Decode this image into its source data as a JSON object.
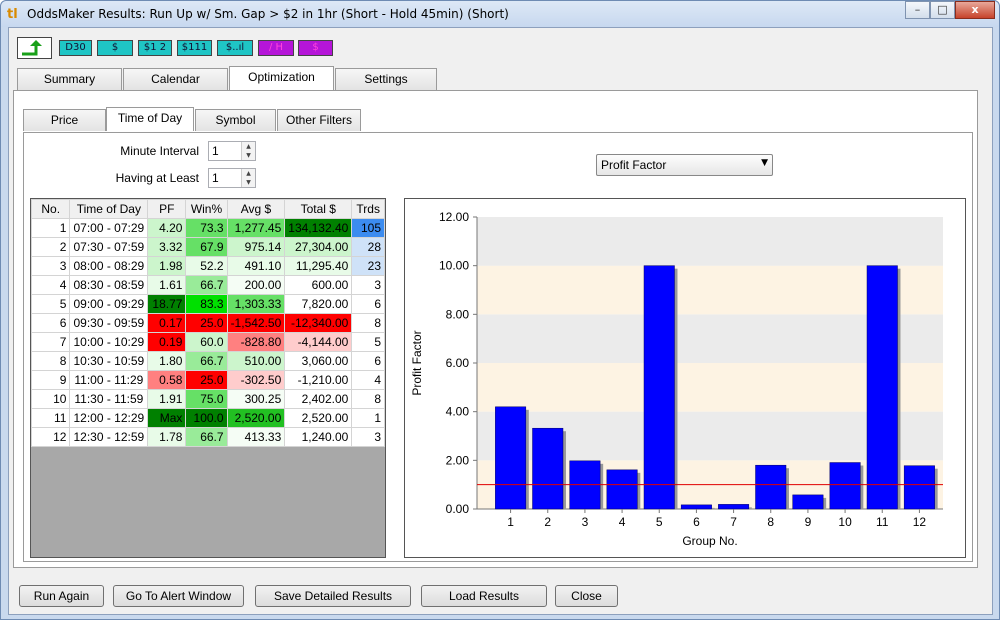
{
  "window": {
    "title": "OddsMaker Results: Run Up w/ Sm. Gap > $2 in 1hr (Short - Hold 45min) (Short)",
    "app_icon": "tl",
    "minimize": "–",
    "maximize": "□",
    "close": "x"
  },
  "toolbar": {
    "items": [
      {
        "label": "D30",
        "icon": "d30-icon"
      },
      {
        "label": "$",
        "icon": "dollar-icon"
      },
      {
        "label": "$1 2",
        "icon": "dollar-12-icon"
      },
      {
        "label": "$111",
        "icon": "dollar-111-icon"
      },
      {
        "label": "$..ıl",
        "icon": "volume-bars-icon"
      },
      {
        "label": "/ H",
        "icon": "high-icon"
      },
      {
        "label": "$",
        "icon": "dollar-purple-icon"
      }
    ]
  },
  "main_tabs": [
    "Summary",
    "Calendar",
    "Optimization",
    "Settings"
  ],
  "sub_tabs": [
    "Price",
    "Time of Day",
    "Symbol",
    "Other Filters"
  ],
  "controls": {
    "minute_interval_label": "Minute Interval",
    "minute_interval_value": "1",
    "having_at_least_label": "Having at Least",
    "having_at_least_value": "1",
    "metric_selected": "Profit Factor"
  },
  "table": {
    "headers": [
      "No.",
      "Time of Day",
      "PF",
      "Win%",
      "Avg $",
      "Total $",
      "Trds"
    ],
    "rows": [
      {
        "no": "1",
        "time": "07:00 - 07:29",
        "pf": "4.20",
        "win": "73.3",
        "avg": "1,277.45",
        "total": "134,132.40",
        "trds": "105"
      },
      {
        "no": "2",
        "time": "07:30 - 07:59",
        "pf": "3.32",
        "win": "67.9",
        "avg": "975.14",
        "total": "27,304.00",
        "trds": "28"
      },
      {
        "no": "3",
        "time": "08:00 - 08:29",
        "pf": "1.98",
        "win": "52.2",
        "avg": "491.10",
        "total": "11,295.40",
        "trds": "23"
      },
      {
        "no": "4",
        "time": "08:30 - 08:59",
        "pf": "1.61",
        "win": "66.7",
        "avg": "200.00",
        "total": "600.00",
        "trds": "3"
      },
      {
        "no": "5",
        "time": "09:00 - 09:29",
        "pf": "18.77",
        "win": "83.3",
        "avg": "1,303.33",
        "total": "7,820.00",
        "trds": "6"
      },
      {
        "no": "6",
        "time": "09:30 - 09:59",
        "pf": "0.17",
        "win": "25.0",
        "avg": "-1,542.50",
        "total": "-12,340.00",
        "trds": "8"
      },
      {
        "no": "7",
        "time": "10:00 - 10:29",
        "pf": "0.19",
        "win": "60.0",
        "avg": "-828.80",
        "total": "-4,144.00",
        "trds": "5"
      },
      {
        "no": "8",
        "time": "10:30 - 10:59",
        "pf": "1.80",
        "win": "66.7",
        "avg": "510.00",
        "total": "3,060.00",
        "trds": "6"
      },
      {
        "no": "9",
        "time": "11:00 - 11:29",
        "pf": "0.58",
        "win": "25.0",
        "avg": "-302.50",
        "total": "-1,210.00",
        "trds": "4"
      },
      {
        "no": "10",
        "time": "11:30 - 11:59",
        "pf": "1.91",
        "win": "75.0",
        "avg": "300.25",
        "total": "2,402.00",
        "trds": "8"
      },
      {
        "no": "11",
        "time": "12:00 - 12:29",
        "pf": "Max",
        "win": "100.0",
        "avg": "2,520.00",
        "total": "2,520.00",
        "trds": "1"
      },
      {
        "no": "12",
        "time": "12:30 - 12:59",
        "pf": "1.78",
        "win": "66.7",
        "avg": "413.33",
        "total": "1,240.00",
        "trds": "3"
      }
    ],
    "cell_colors": {
      "pf": [
        "#ccf5cc",
        "#ccf5cc",
        "#ccf5cc",
        "#e8fbe8",
        "#008000",
        "#ff0000",
        "#ff0000",
        "#e8fbe8",
        "#ff8080",
        "#e8fbe8",
        "#008000",
        "#e8fbe8"
      ],
      "win": [
        "#66e066",
        "#66e066",
        "#e8fbe8",
        "#99eb99",
        "#00e000",
        "#ff0000",
        "#ccf5cc",
        "#99eb99",
        "#ff0000",
        "#66e066",
        "#008000",
        "#99eb99"
      ],
      "avg": [
        "#66e066",
        "#ccf5cc",
        "#e8fbe8",
        "#f5fdf5",
        "#66e066",
        "#ff0000",
        "#ff8080",
        "#ccf5cc",
        "#ffcccc",
        "#f5fdf5",
        "#22c022",
        "#f5fdf5"
      ],
      "total": [
        "#008000",
        "#ccf5cc",
        "#e8fbe8",
        "#ffffff",
        "#ffffff",
        "#ff0000",
        "#ffcccc",
        "#ffffff",
        "#ffffff",
        "#ffffff",
        "#ffffff",
        "#ffffff"
      ],
      "trds": [
        "#3c8cf0",
        "#cfe2f8",
        "#cfe2f8",
        "#ffffff",
        "#ffffff",
        "#ffffff",
        "#ffffff",
        "#ffffff",
        "#ffffff",
        "#ffffff",
        "#ffffff",
        "#ffffff"
      ]
    }
  },
  "chart_data": {
    "type": "bar",
    "categories": [
      "1",
      "2",
      "3",
      "4",
      "5",
      "6",
      "7",
      "8",
      "9",
      "10",
      "11",
      "12"
    ],
    "values": [
      4.2,
      3.32,
      1.98,
      1.61,
      10.0,
      0.17,
      0.19,
      1.8,
      0.58,
      1.91,
      10.0,
      1.78
    ],
    "title": "",
    "xlabel": "Group No.",
    "ylabel": "Profit Factor",
    "ylim": [
      0,
      12
    ],
    "yticks": [
      "0.00",
      "2.00",
      "4.00",
      "6.00",
      "8.00",
      "10.00",
      "12.00"
    ],
    "reference_line": 1.0,
    "bar_color": "#0000ff",
    "reference_color": "#e00000",
    "band_colors": [
      "#fdf3e3",
      "#ebebeb"
    ],
    "grid": false,
    "legend": "none"
  },
  "buttons": {
    "run_again": "Run Again",
    "go_to_alert": "Go To Alert Window",
    "save_detailed": "Save Detailed Results",
    "load_results": "Load Results",
    "close": "Close"
  }
}
